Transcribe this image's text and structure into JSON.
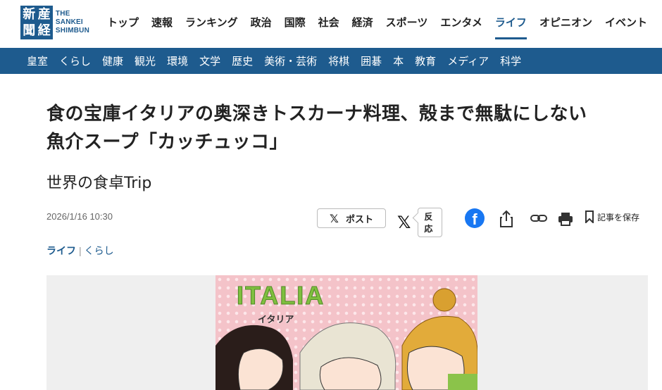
{
  "header": {
    "logo": {
      "mark_chars": [
        "新",
        "産",
        "聞",
        "経"
      ],
      "text_lines": [
        "THE",
        "SANKEI",
        "SHIMBUN"
      ]
    },
    "nav": [
      {
        "label": "トップ",
        "active": false
      },
      {
        "label": "速報",
        "active": false
      },
      {
        "label": "ランキング",
        "active": false
      },
      {
        "label": "政治",
        "active": false
      },
      {
        "label": "国際",
        "active": false
      },
      {
        "label": "社会",
        "active": false
      },
      {
        "label": "経済",
        "active": false
      },
      {
        "label": "スポーツ",
        "active": false
      },
      {
        "label": "エンタメ",
        "active": false
      },
      {
        "label": "ライフ",
        "active": true
      },
      {
        "label": "オピニオン",
        "active": false
      },
      {
        "label": "イベント",
        "active": false
      }
    ],
    "subnav": [
      "皇室",
      "くらし",
      "健康",
      "観光",
      "環境",
      "文学",
      "歴史",
      "美術・芸術",
      "将棋",
      "囲碁",
      "本",
      "教育",
      "メディア",
      "科学"
    ]
  },
  "article": {
    "title_line1": "食の宝庫イタリアの奥深きトスカーナ料理、殻まで無駄にしない",
    "title_line2": "魚介スープ「カッチュッコ」",
    "subtitle": "世界の食卓Trip",
    "date": "2026/1/16 10:30",
    "category_primary": "ライフ",
    "category_separator": "|",
    "category_secondary": "くらし"
  },
  "share": {
    "post_label": "ポスト",
    "react_label": "反応",
    "save_label": "記事を保存",
    "icons": [
      "x-icon",
      "facebook-icon",
      "share-icon",
      "link-icon",
      "print-icon",
      "bookmark-icon"
    ]
  },
  "hero": {
    "illustration_title": "ITALIA",
    "illustration_subtitle": "イタリア"
  },
  "colors": {
    "brand": "#1e5b8e",
    "facebook": "#1877f2",
    "illustration_bg": "#f4c3c9",
    "illustration_title": "#7fbf3f"
  }
}
